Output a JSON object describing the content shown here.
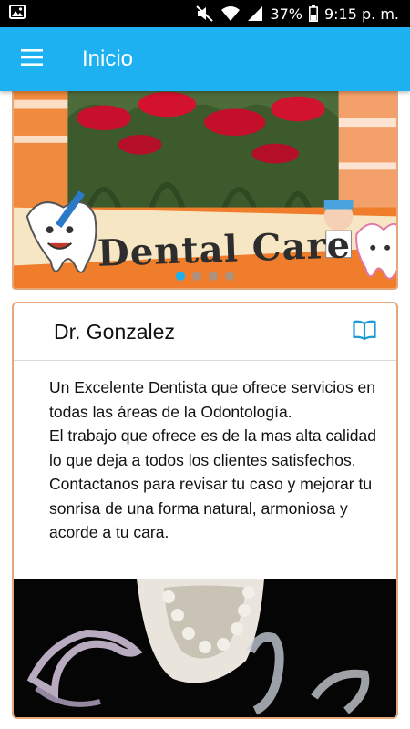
{
  "status_bar": {
    "battery": "37%",
    "time": "9:15 p. m.",
    "icons": [
      "image-icon",
      "mute-icon",
      "wifi-icon",
      "signal-icon",
      "battery-icon"
    ]
  },
  "app_bar": {
    "title": "Inicio",
    "menu_icon": "hamburger-menu-icon",
    "background_color": "#1db1f2"
  },
  "carousel": {
    "banner_text": "Dental Care",
    "slide_count": 4,
    "active_index": 0,
    "accent_color": "#1db1f2"
  },
  "profile_card": {
    "title": "Dr. Gonzalez",
    "action_icon": "open-book-icon",
    "paragraphs": [
      "Un Excelente Dentista que ofrece servicios en todas las áreas de la Odontología.",
      "El trabajo que ofrece es de la mas alta calidad lo que deja a todos los clientes satisfechos.",
      "Contactanos para revisar tu caso y mejorar tu sonrisa de una forma natural, armoniosa y acorde a tu cara."
    ],
    "border_color": "#e6a77a"
  }
}
